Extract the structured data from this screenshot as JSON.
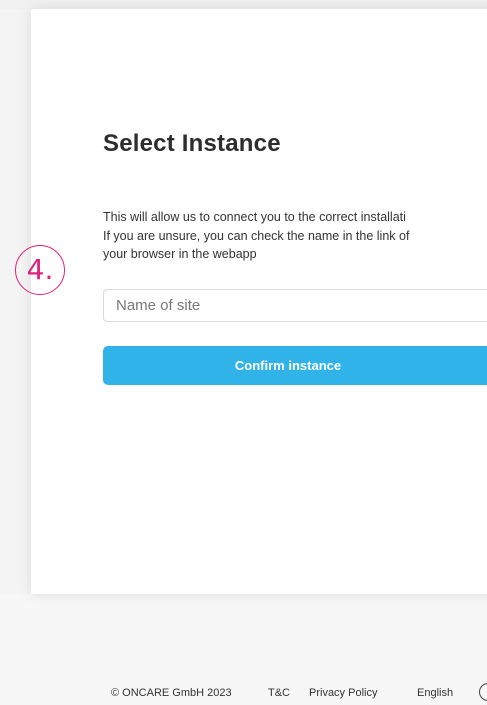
{
  "form": {
    "title": "Select Instance",
    "description_lines": [
      "This will allow us to connect you to the correct installati",
      "If you are unsure, you can check the name in the link of",
      "your browser in the webapp"
    ],
    "site_input": {
      "placeholder": "Name of site",
      "value": ""
    },
    "confirm_label": "Confirm instance"
  },
  "annotation": {
    "step_label": "4."
  },
  "footer": {
    "copyright": "© ONCARE GmbH 2023",
    "tc_link": "T&C",
    "privacy_link": "Privacy Policy",
    "language": "English",
    "language_icon": "globe-icon"
  },
  "colors": {
    "accent": "#2fb3e8",
    "annotation": "#e0217c",
    "text": "#2d2d2d"
  }
}
